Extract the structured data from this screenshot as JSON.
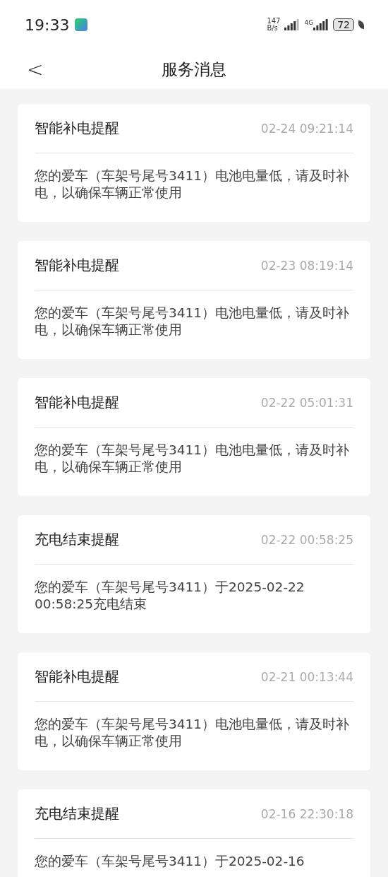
{
  "status_bar": {
    "time": "19:33",
    "net_speed_value": "147",
    "net_speed_unit": "B/s",
    "network_type": "4G",
    "battery": "72"
  },
  "header": {
    "back": "<",
    "title": "服务消息"
  },
  "messages": [
    {
      "title": "智能补电提醒",
      "time": "02-24 09:21:14",
      "body": "您的爱车（车架号尾号3411）电池电量低，请及时补电，以确保车辆正常使用"
    },
    {
      "title": "智能补电提醒",
      "time": "02-23 08:19:14",
      "body": "您的爱车（车架号尾号3411）电池电量低，请及时补电，以确保车辆正常使用"
    },
    {
      "title": "智能补电提醒",
      "time": "02-22 05:01:31",
      "body": "您的爱车（车架号尾号3411）电池电量低，请及时补电，以确保车辆正常使用"
    },
    {
      "title": "充电结束提醒",
      "time": "02-22 00:58:25",
      "body": "您的爱车（车架号尾号3411）于2025-02-22 00:58:25充电结束"
    },
    {
      "title": "智能补电提醒",
      "time": "02-21 00:13:44",
      "body": "您的爱车（车架号尾号3411）电池电量低，请及时补电，以确保车辆正常使用"
    },
    {
      "title": "充电结束提醒",
      "time": "02-16 22:30:18",
      "body": "您的爱车（车架号尾号3411）于2025-02-16"
    }
  ]
}
